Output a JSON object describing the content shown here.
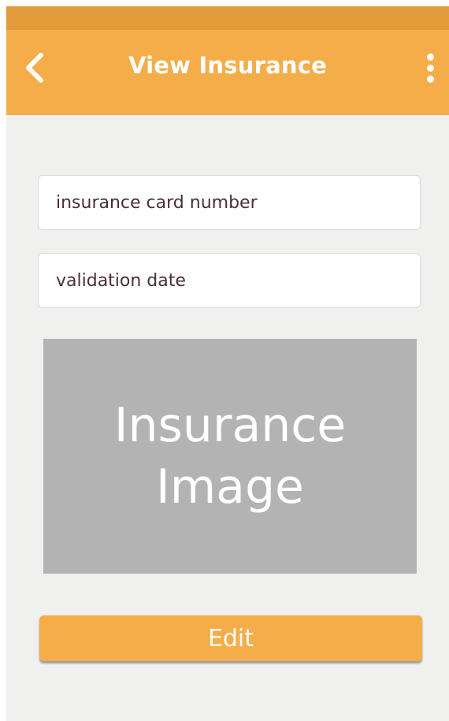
{
  "colors": {
    "status_bar": "#e29b38",
    "app_bar": "#f4ad49",
    "background": "#f0f0ef",
    "field_text": "#4a2f33",
    "image_placeholder": "#b3b3b3",
    "button": "#f4ad49"
  },
  "header": {
    "back_icon": "chevron-left-icon",
    "title": "View Insurance",
    "menu_icon": "more-vertical-icon"
  },
  "form": {
    "card_number_placeholder": "insurance card number",
    "validation_date_placeholder": "validation date"
  },
  "image_placeholder": {
    "text": "Insurance\nImage"
  },
  "actions": {
    "edit_label": "Edit"
  }
}
